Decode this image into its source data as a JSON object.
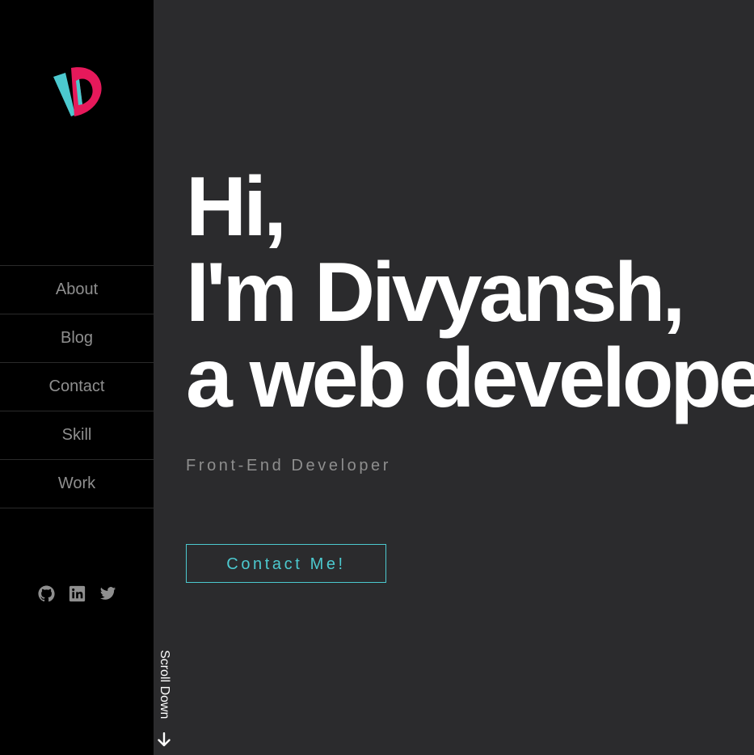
{
  "brand": {
    "logo_icon": "d-monogram-logo",
    "colors": {
      "primary": "#e6195b",
      "secondary": "#4cc9cf"
    }
  },
  "sidebar": {
    "items": [
      {
        "label": "About"
      },
      {
        "label": "Blog"
      },
      {
        "label": "Contact"
      },
      {
        "label": "Skill"
      },
      {
        "label": "Work"
      }
    ],
    "social": [
      {
        "icon": "github-icon"
      },
      {
        "icon": "linkedin-icon"
      },
      {
        "icon": "twitter-icon"
      }
    ]
  },
  "main": {
    "hero_lines": [
      "Hi,",
      "I'm Divyansh,",
      "a web developer"
    ],
    "subtitle": "Front-End Developer",
    "cta_label": "Contact Me!",
    "scroll_label": "Scroll Down",
    "colors": {
      "background": "#2b2b2d",
      "accent": "#4cc9cf",
      "heading": "#ffffff",
      "muted": "#8e8e8e"
    }
  }
}
